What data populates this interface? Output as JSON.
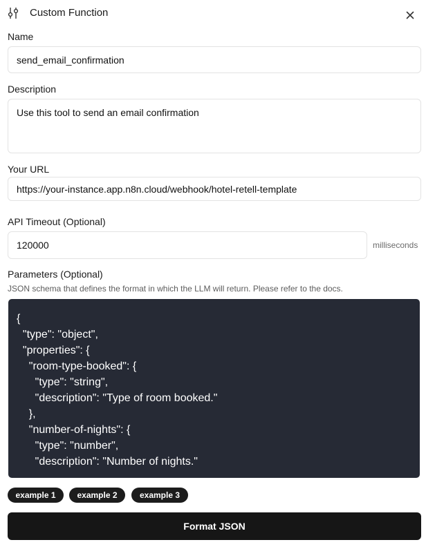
{
  "header": {
    "title": "Custom Function",
    "icon": "function-sliders-icon",
    "close_icon": "close-icon"
  },
  "form": {
    "name": {
      "label": "Name",
      "value": "send_email_confirmation"
    },
    "description": {
      "label": "Description",
      "value": "Use this tool to send an email confirmation"
    },
    "url": {
      "label": "Your URL",
      "value": "https://your-instance.app.n8n.cloud/webhook/hotel-retell-template"
    },
    "timeout": {
      "label": "API Timeout (Optional)",
      "value": "120000",
      "suffix": "milliseconds"
    },
    "parameters": {
      "label": "Parameters (Optional)",
      "hint": "JSON schema that defines the format in which the LLM will return. Please refer to the docs.",
      "code_lines": [
        "{",
        "  \"type\": \"object\",",
        "  \"properties\": {",
        "    \"room-type-booked\": {",
        "      \"type\": \"string\",",
        "      \"description\": \"Type of room booked.\"",
        "    },",
        "    \"number-of-nights\": {",
        "      \"type\": \"number\",",
        "      \"description\": \"Number of nights.\""
      ]
    }
  },
  "examples": [
    "example 1",
    "example 2",
    "example 3"
  ],
  "format_button": "Format JSON",
  "colors": {
    "code_background": "#262a35",
    "button_background": "#161616",
    "chip_background": "#1c1c1c"
  }
}
